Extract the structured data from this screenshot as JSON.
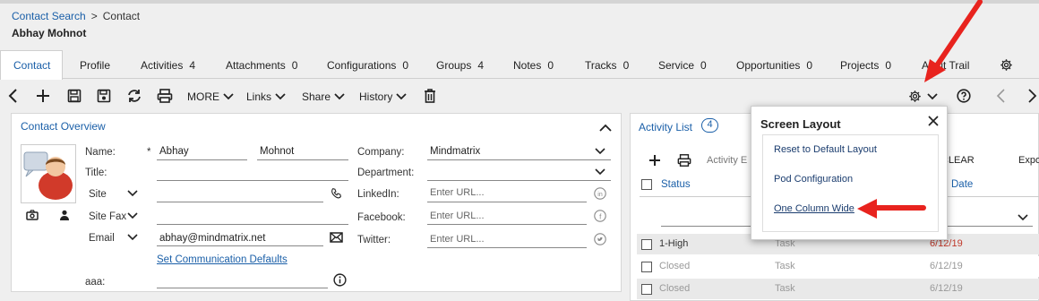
{
  "breadcrumb": {
    "link": "Contact Search",
    "separator": ">",
    "current": "Contact"
  },
  "person_name": "Abhay Mohnot",
  "tabs": [
    {
      "label": "Contact",
      "count": ""
    },
    {
      "label": "Profile",
      "count": ""
    },
    {
      "label": "Activities",
      "count": "4"
    },
    {
      "label": "Attachments",
      "count": "0"
    },
    {
      "label": "Configurations",
      "count": "0"
    },
    {
      "label": "Groups",
      "count": "4"
    },
    {
      "label": "Notes",
      "count": "0"
    },
    {
      "label": "Tracks",
      "count": "0"
    },
    {
      "label": "Service",
      "count": "0"
    },
    {
      "label": "Opportunities",
      "count": "0"
    },
    {
      "label": "Projects",
      "count": "0"
    },
    {
      "label": "Audit Trail",
      "count": ""
    }
  ],
  "toolbar": {
    "more": "MORE",
    "links": "Links",
    "share": "Share",
    "history": "History"
  },
  "overview": {
    "title": "Contact Overview",
    "name_label": "Name:",
    "required_mark": "*",
    "first_name": "Abhay",
    "last_name": "Mohnot",
    "title_label": "Title:",
    "site_label": "Site",
    "site_fax_label": "Site Fax",
    "email_label": "Email",
    "email_value": "abhay@mindmatrix.net",
    "comm_defaults": "Set Communication Defaults",
    "aaa_label": "aaa:",
    "company_label": "Company:",
    "company_value": "Mindmatrix",
    "department_label": "Department:",
    "linkedin_label": "LinkedIn:",
    "facebook_label": "Facebook:",
    "twitter_label": "Twitter:",
    "url_placeholder": "Enter URL..."
  },
  "activity": {
    "title": "Activity List",
    "count": "4",
    "clear": "CLEAR",
    "export": "Expo",
    "col_status": "Status",
    "col_date": "Date",
    "hidden_col_fragment": "Activity E",
    "rows": [
      {
        "status": "1-High",
        "type": "Task",
        "date": "6/12/19",
        "date_color": "#c0392b",
        "status_color": "#333"
      },
      {
        "status": "Closed",
        "type": "Task",
        "date": "6/12/19",
        "date_color": "#999",
        "status_color": "#999"
      },
      {
        "status": "Closed",
        "type": "Task",
        "date": "6/12/19",
        "date_color": "#999",
        "status_color": "#999"
      }
    ]
  },
  "screen_layout": {
    "title": "Screen Layout",
    "items": [
      "Reset to Default Layout",
      "Pod Configuration",
      "One Column Wide"
    ]
  },
  "colors": {
    "accent": "#1a5fa8",
    "arrow": "#e8231e"
  }
}
